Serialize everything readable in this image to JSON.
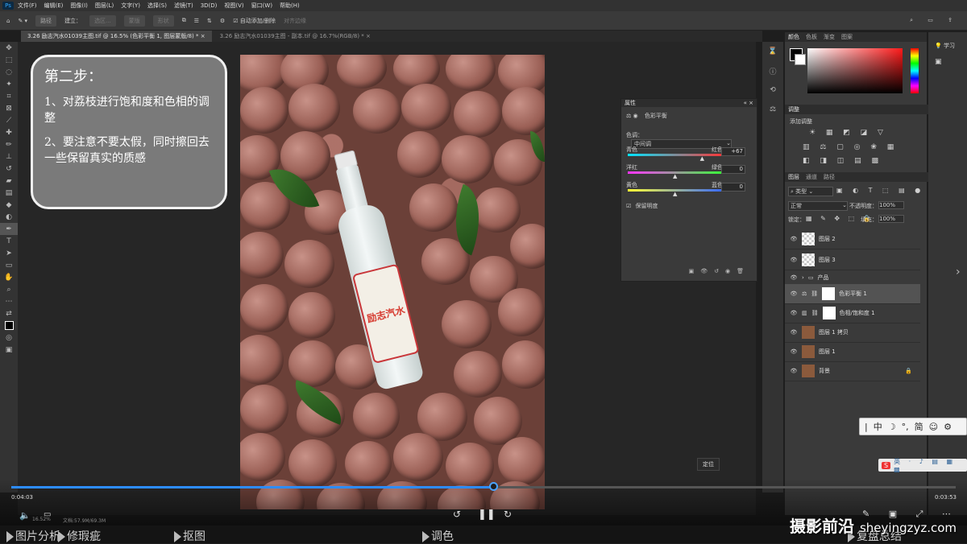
{
  "menubar": {
    "items": [
      "文件(F)",
      "编辑(E)",
      "图像(I)",
      "图层(L)",
      "文字(Y)",
      "选择(S)",
      "滤镜(T)",
      "3D(D)",
      "视图(V)",
      "窗口(W)",
      "帮助(H)"
    ]
  },
  "options": {
    "mode": "路径",
    "make_label": "建立：",
    "select": "选区...",
    "mask": "蒙版",
    "shape": "形状",
    "auto_add": "自动添加/删除",
    "align": "对齐边缘"
  },
  "tabs": [
    {
      "label": "3.26 励志汽水01039主图.tif @ 16.5% (色彩平衡 1, 图层蒙版/8) *"
    },
    {
      "label": "3.26 励志汽水01039主图 - 副本.tif @ 16.7%(RGB/8) *"
    }
  ],
  "note": {
    "title": "第二步：",
    "p1": "1、对荔枝进行饱和度和色相的调整",
    "p2": "2、要注意不要太假，同时擦回去一些保留真实的质感"
  },
  "bottle": {
    "label": "励志汽水"
  },
  "props": {
    "header": "属性",
    "title": "色彩平衡",
    "tone_label": "色调：",
    "tone_value": "中间调",
    "sliders": [
      {
        "left": "青色",
        "right": "红色",
        "value": "+67",
        "pos": 0.78
      },
      {
        "left": "洋红",
        "right": "绿色",
        "value": "0",
        "pos": 0.5
      },
      {
        "left": "黄色",
        "right": "蓝色",
        "value": "0",
        "pos": 0.5
      }
    ],
    "preserve": "保留明度"
  },
  "color_panel": {
    "tabs": [
      "颜色",
      "色板",
      "渐变",
      "图案"
    ]
  },
  "adjust_panel": {
    "header": "调整",
    "add": "添加调整"
  },
  "layers_panel": {
    "tabs": [
      "图层",
      "通道",
      "路径"
    ],
    "kind": "类型",
    "blend": "正常",
    "opacity_label": "不透明度：",
    "opacity": "100%",
    "lock_label": "锁定：",
    "fill_label": "填充：",
    "fill": "100%",
    "layers": [
      {
        "name": "图层 2"
      },
      {
        "name": "图层 3"
      },
      {
        "name": "产品"
      },
      {
        "name": "色彩平衡 1"
      },
      {
        "name": "色相/饱和度 1"
      },
      {
        "name": "图层 1 拷贝"
      },
      {
        "name": "图层 1"
      },
      {
        "name": "背景"
      }
    ]
  },
  "far_right": {
    "learn": "学习"
  },
  "video": {
    "current": "0:04:03",
    "total": "0:03:53",
    "progress": 0.51,
    "zoom": "16.52%",
    "doc": "文档:57.9M/69.3M",
    "tooltip": "定位"
  },
  "chapters": [
    "图片分析",
    "修瑕疵",
    "抠图",
    "调色",
    "复盘总结"
  ],
  "ime": {
    "items": [
      "中",
      "☽",
      "°,",
      "简",
      "☺",
      "⚙"
    ]
  },
  "watermark": {
    "cn": "摄影前沿",
    "url": "sheyingzyz.com"
  },
  "colors": {
    "accent": "#2d8cff",
    "note_bg": "#7a7a7a"
  }
}
